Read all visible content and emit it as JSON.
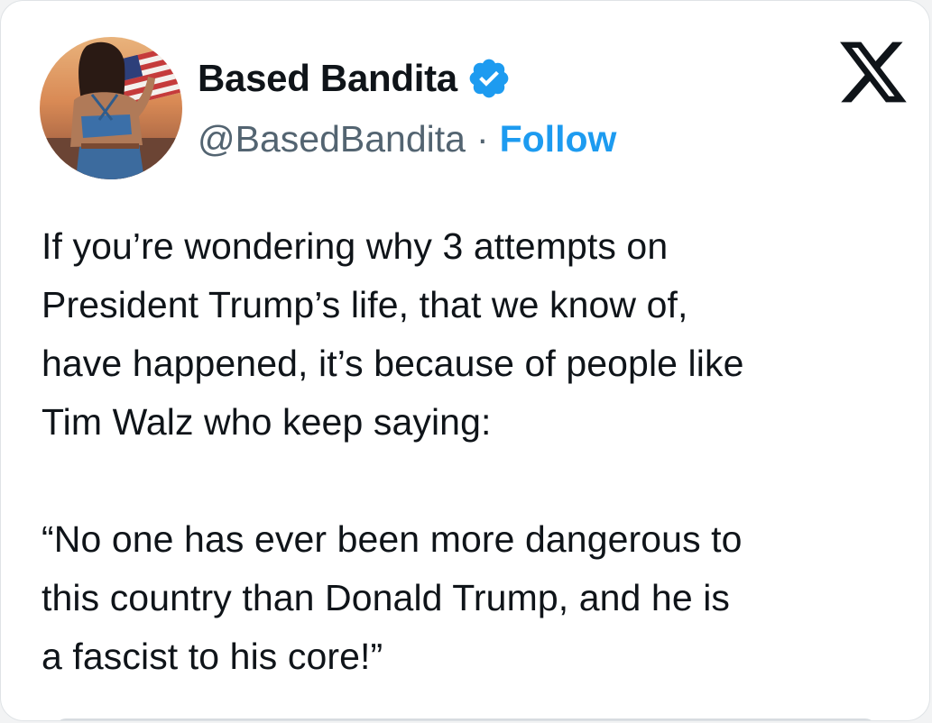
{
  "post": {
    "author": {
      "display_name": "Based Bandita",
      "handle": "@BasedBandita",
      "separator": "·",
      "follow_label": "Follow",
      "verified": true,
      "avatar_icon": "avatar-photo-woman-with-flag"
    },
    "platform_icon": "x-logo-icon",
    "text": "If you’re wondering why 3 attempts on\nPresident Trump’s life, that we know of,\nhave happened, it’s because of people like\nTim Walz who keep saying:\n\n“No one has ever been more dangerous to\nthis country than Donald Trump, and he is\na fascist to his core!”"
  },
  "colors": {
    "verified_badge": "#1d9bf0",
    "follow_link": "#1d9bf0",
    "secondary_text": "#536471",
    "primary_text": "#0f1419"
  }
}
